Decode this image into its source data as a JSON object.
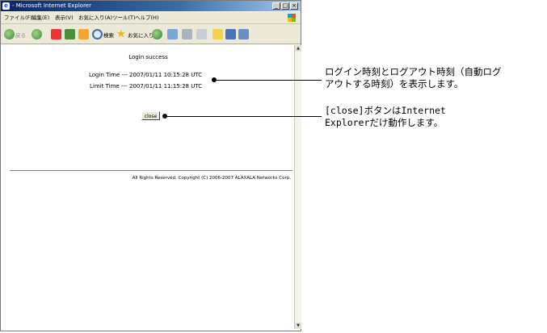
{
  "window": {
    "title": "- Microsoft Internet Explorer",
    "controls": [
      "_",
      "□",
      "×"
    ]
  },
  "menu": [
    "ファイル(F)",
    "編集(E)",
    "表示(V)",
    "お気に入り(A)",
    "ツール(T)",
    "ヘルプ(H)"
  ],
  "toolbar": {
    "back_label": "戻る",
    "search_label": "検索",
    "favorites_label": "お気に入り"
  },
  "page": {
    "title": "Login success",
    "login_label": "Login Time ---",
    "login_value": "2007/01/11 10:15:28 UTC",
    "limit_label": "Limit Time ---",
    "limit_value": "2007/01/11 11:15:28 UTC",
    "close_label": "close",
    "copyright": "All Rights Reserved, Copyright (C) 2006-2007 ALAXALA Networks Corp."
  },
  "annotations": {
    "time_note_line1": "ログイン時刻とログアウト時刻（自動ログ",
    "time_note_line2": "アウトする時刻）を表示します。",
    "close_note_line1": "[close]ボタンはInternet",
    "close_note_line2": "Explorerだけ動作します。"
  }
}
